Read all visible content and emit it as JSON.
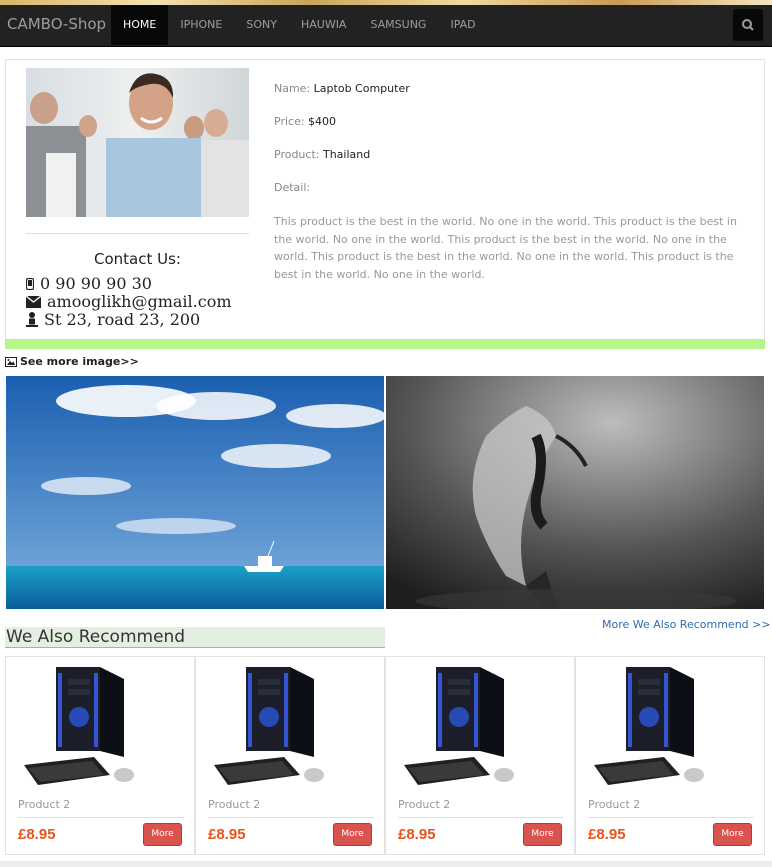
{
  "navbar": {
    "brand": "CAMBO-Shop",
    "items": [
      {
        "label": "HOME",
        "active": true
      },
      {
        "label": "IPHONE",
        "active": false
      },
      {
        "label": "SONY",
        "active": false
      },
      {
        "label": "HAUWIA",
        "active": false
      },
      {
        "label": "SAMSUNG",
        "active": false
      },
      {
        "label": "IPAD",
        "active": false
      }
    ],
    "search_icon": "search-icon"
  },
  "contact": {
    "title": "Contact Us:",
    "phone": "0 90 90 90 30",
    "email": "amooglikh@gmail.com",
    "address": "St 23, road 23, 200"
  },
  "product": {
    "name_label": "Name:",
    "name": "Laptob Computer",
    "price_label": "Price:",
    "price": "$400",
    "product_label": "Product:",
    "product": "Thailand",
    "detail_label": "Detail:",
    "description": "This product is the best in the world. No one in the world. This product is the best in the world. No one in the world. This product is the best in the world. No one in the world. This product is the best in the world. No one in the world. This product is the best in the world. No one in the world."
  },
  "gallery": {
    "see_more": "See more image>>"
  },
  "recommend": {
    "title": "We Also Recommend",
    "more_link": "More We Also Recommend >>",
    "items": [
      {
        "name": "Product 2",
        "price": "£8.95",
        "button": "More"
      },
      {
        "name": "Product 2",
        "price": "£8.95",
        "button": "More"
      },
      {
        "name": "Product 2",
        "price": "£8.95",
        "button": "More"
      },
      {
        "name": "Product 2",
        "price": "£8.95",
        "button": "More"
      }
    ]
  },
  "colors": {
    "navbar_bg": "#222222",
    "accent_bar": "#b6f58a",
    "price": "#e8541a",
    "more_button": "#d9534f",
    "link": "#2a6db3"
  }
}
